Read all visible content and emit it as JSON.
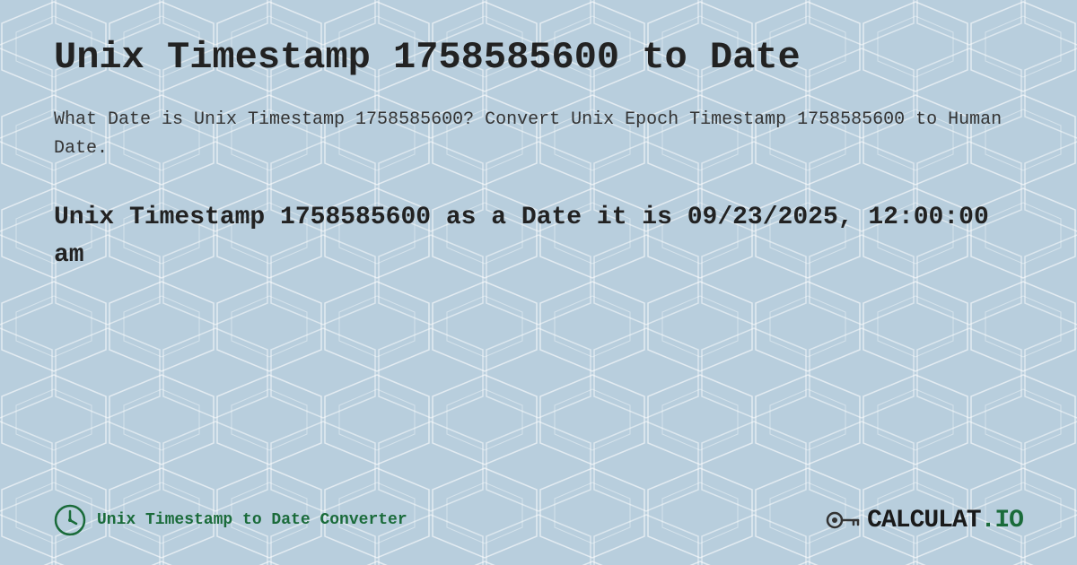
{
  "page": {
    "background_color": "#c8d8e8"
  },
  "header": {
    "title": "Unix Timestamp 1758585600 to Date"
  },
  "description": {
    "text": "What Date is Unix Timestamp 1758585600? Convert Unix Epoch Timestamp 1758585600 to Human Date."
  },
  "result": {
    "text": "Unix Timestamp 1758585600 as a Date it is 09/23/2025, 12:00:00 am"
  },
  "footer": {
    "converter_label": "Unix Timestamp to Date Converter",
    "logo_text": "CALCULAT.IO"
  }
}
